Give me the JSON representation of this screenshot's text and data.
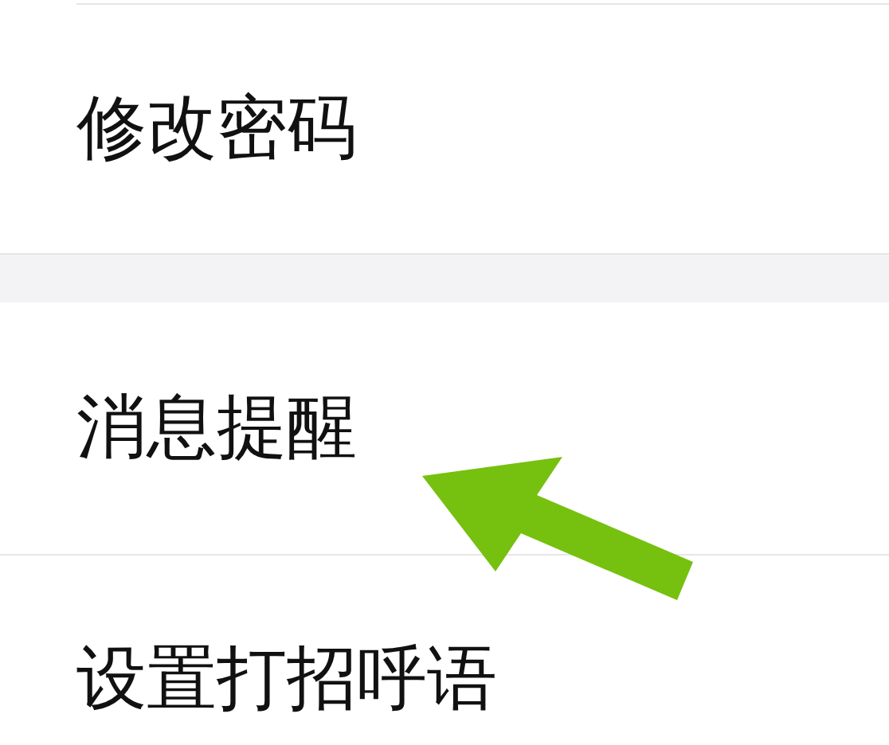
{
  "settings_groups": [
    {
      "items": [
        {
          "label": "修改密码"
        }
      ]
    },
    {
      "items": [
        {
          "label": "消息提醒"
        },
        {
          "label": "设置打招呼语"
        }
      ]
    }
  ]
}
